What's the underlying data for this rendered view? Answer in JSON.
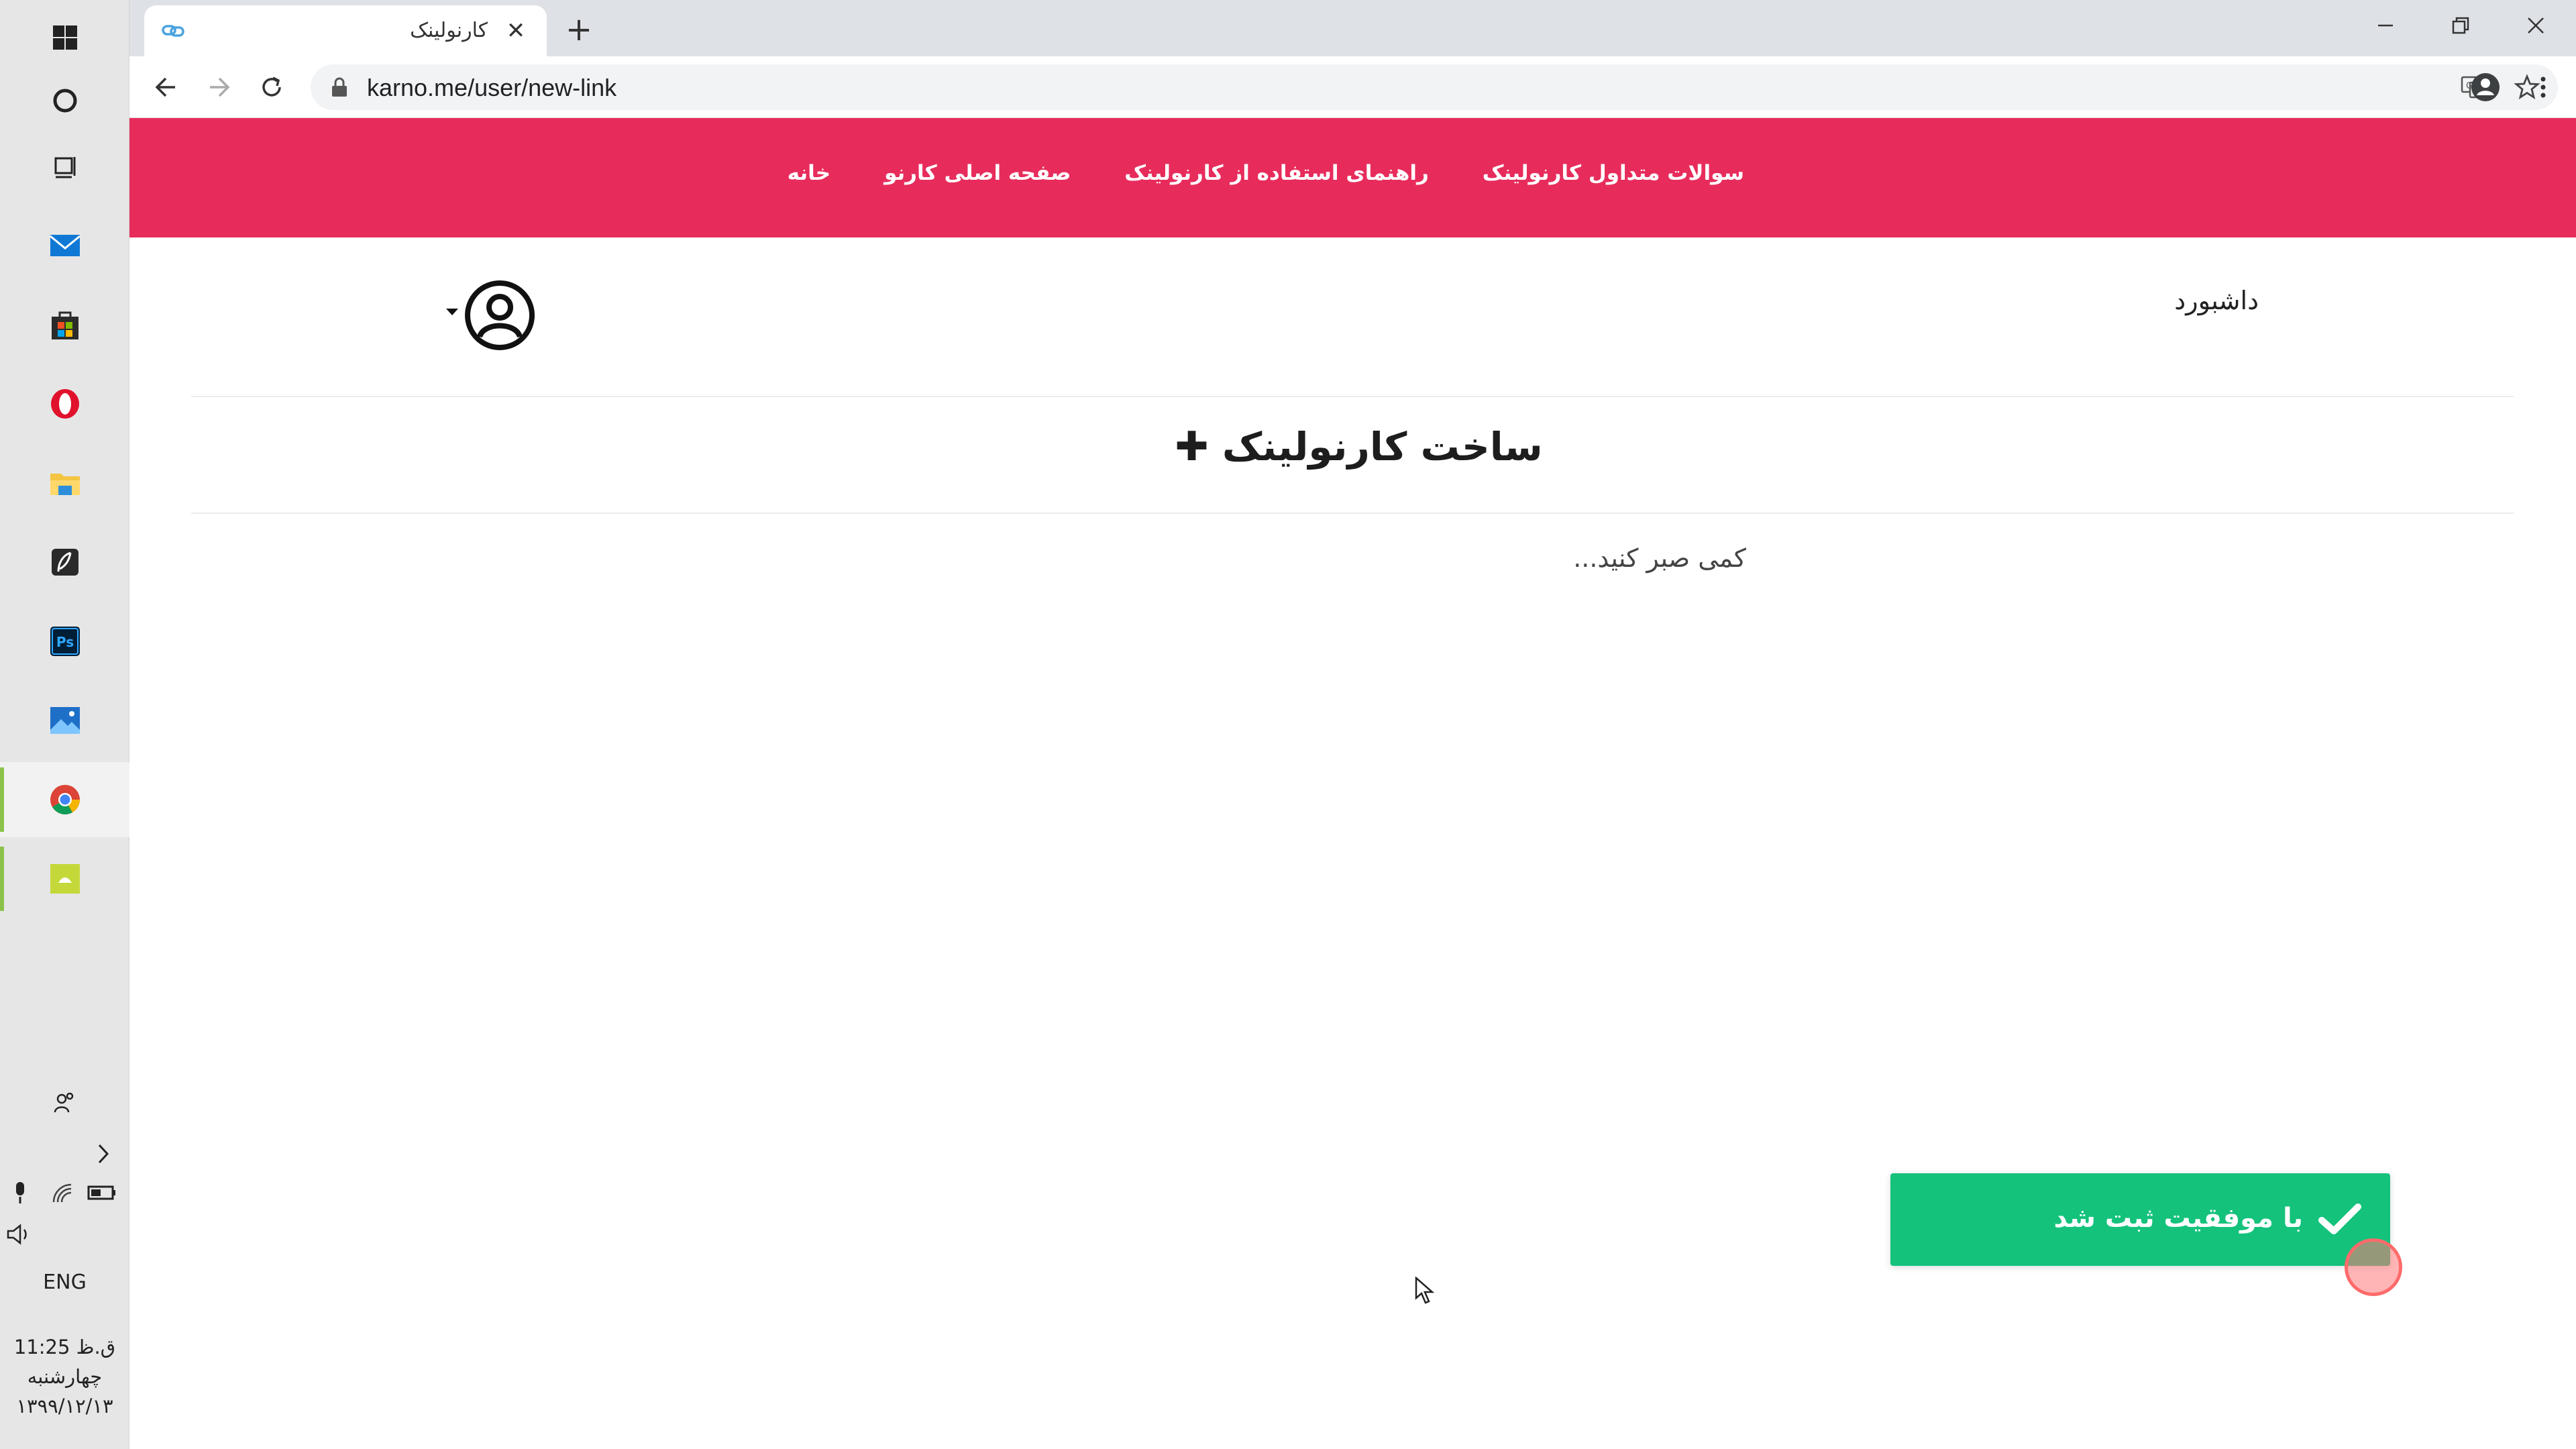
{
  "taskbar": {
    "pinned": [
      {
        "icon": "windows-start-icon"
      },
      {
        "icon": "cortana-search-icon"
      },
      {
        "icon": "task-view-icon"
      },
      {
        "icon": "mail-icon"
      },
      {
        "icon": "microsoft-store-icon"
      },
      {
        "icon": "opera-icon"
      },
      {
        "icon": "file-explorer-icon"
      },
      {
        "icon": "feather-app-icon"
      },
      {
        "icon": "photoshop-icon"
      },
      {
        "icon": "photos-icon"
      },
      {
        "icon": "chrome-icon"
      },
      {
        "icon": "green-app-icon"
      }
    ],
    "tray": {
      "language": "ENG",
      "time": "ق.ظ 11:25",
      "weekday": "چهارشنبه",
      "date": "۱۳۹۹/۱۲/۱۳"
    }
  },
  "browser": {
    "tab_title": "کارنولینک",
    "url": "karno.me/user/new-link",
    "new_tab_symbol": "+",
    "close_tab_symbol": "✕"
  },
  "site": {
    "nav_links": [
      "خانه",
      "صفحه اصلی کارنو",
      "راهنمای استفاده از کارنولینک",
      "سوالات متداول کارنولینک"
    ],
    "dashboard_title": "داشبورد",
    "create_title": "ساخت کارنولینک",
    "create_plus": "✚",
    "wait_text": "کمی صبر کنید..."
  },
  "toast": {
    "message": "با موفقیت ثبت شد",
    "color": "#14c27c"
  },
  "colors": {
    "nav_bg": "#e72c5c",
    "tab_strip": "#dee1e6"
  }
}
